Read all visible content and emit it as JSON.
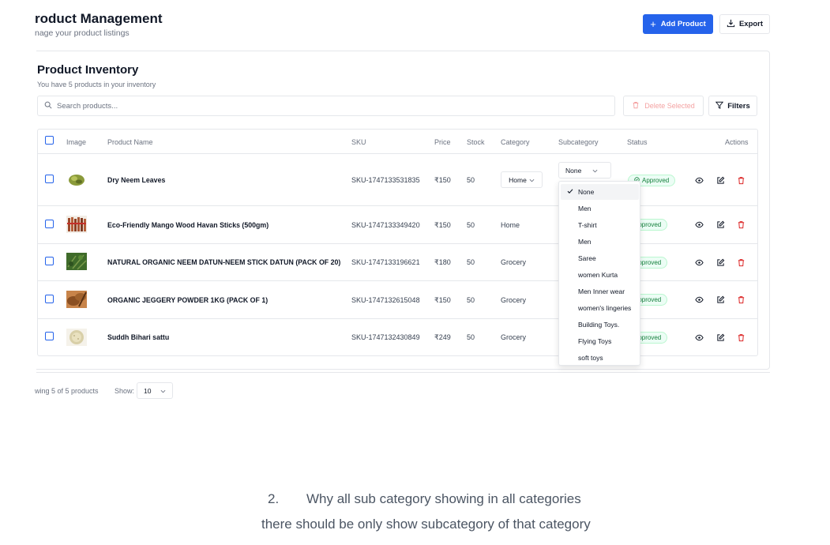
{
  "header": {
    "title": "roduct Management",
    "subtitle": "nage your product listings",
    "add_button": "Add Product",
    "export_button": "Export"
  },
  "inventory": {
    "title": "Product Inventory",
    "subtitle": "You have 5 products in your inventory",
    "search_placeholder": "Search products...",
    "delete_selected": "Delete Selected",
    "filters": "Filters"
  },
  "table": {
    "columns": [
      "Image",
      "Product Name",
      "SKU",
      "Price",
      "Stock",
      "Category",
      "Subcategory",
      "Status",
      "Actions"
    ],
    "rows": [
      {
        "name": "Dry Neem Leaves",
        "sku": "SKU-1747133531835",
        "price": "₹150",
        "stock": "50",
        "category": "Home",
        "subcategory": "None",
        "status": "Approved",
        "thumb_color": "#8a9a3a"
      },
      {
        "name": "Eco-Friendly Mango Wood Havan Sticks (500gm)",
        "sku": "SKU-1747133349420",
        "price": "₹150",
        "stock": "50",
        "category": "Home",
        "status": "Approved",
        "thumb_color": "#9c4a2c"
      },
      {
        "name": "NATURAL ORGANIC NEEM DATUN-NEEM STICK DATUN (PACK OF 20)",
        "sku": "SKU-1747133196621",
        "price": "₹180",
        "stock": "50",
        "category": "Grocery",
        "status": "Approved",
        "thumb_color": "#3f6b2a"
      },
      {
        "name": "ORGANIC JEGGERY POWDER 1KG (PACK OF 1)",
        "sku": "SKU-1747132615048",
        "price": "₹150",
        "stock": "50",
        "category": "Grocery",
        "status": "Approved",
        "thumb_color": "#a0622d"
      },
      {
        "name": "Suddh Bihari sattu",
        "sku": "SKU-1747132430849",
        "price": "₹249",
        "stock": "50",
        "category": "Grocery",
        "status": "Approved",
        "thumb_color": "#d8cfa8"
      }
    ]
  },
  "subcategory_dropdown": {
    "options": [
      "None",
      "Men",
      "T-shirt",
      "Men",
      "Saree",
      "women Kurta",
      "Men Inner wear",
      "women's lingeries",
      "Building Toys.",
      "Flying Toys",
      "soft toys"
    ],
    "selected": "None"
  },
  "footer": {
    "showing": "wing 5 of 5 products",
    "show_label": "Show:",
    "page_size": "10"
  },
  "comment": {
    "number": "2.",
    "line1": "Why all sub category showing in all categories",
    "line2": "there should be only show subcategory of that category"
  },
  "colors": {
    "primary": "#2563eb",
    "danger": "#dc2626",
    "success": "#15803d"
  }
}
